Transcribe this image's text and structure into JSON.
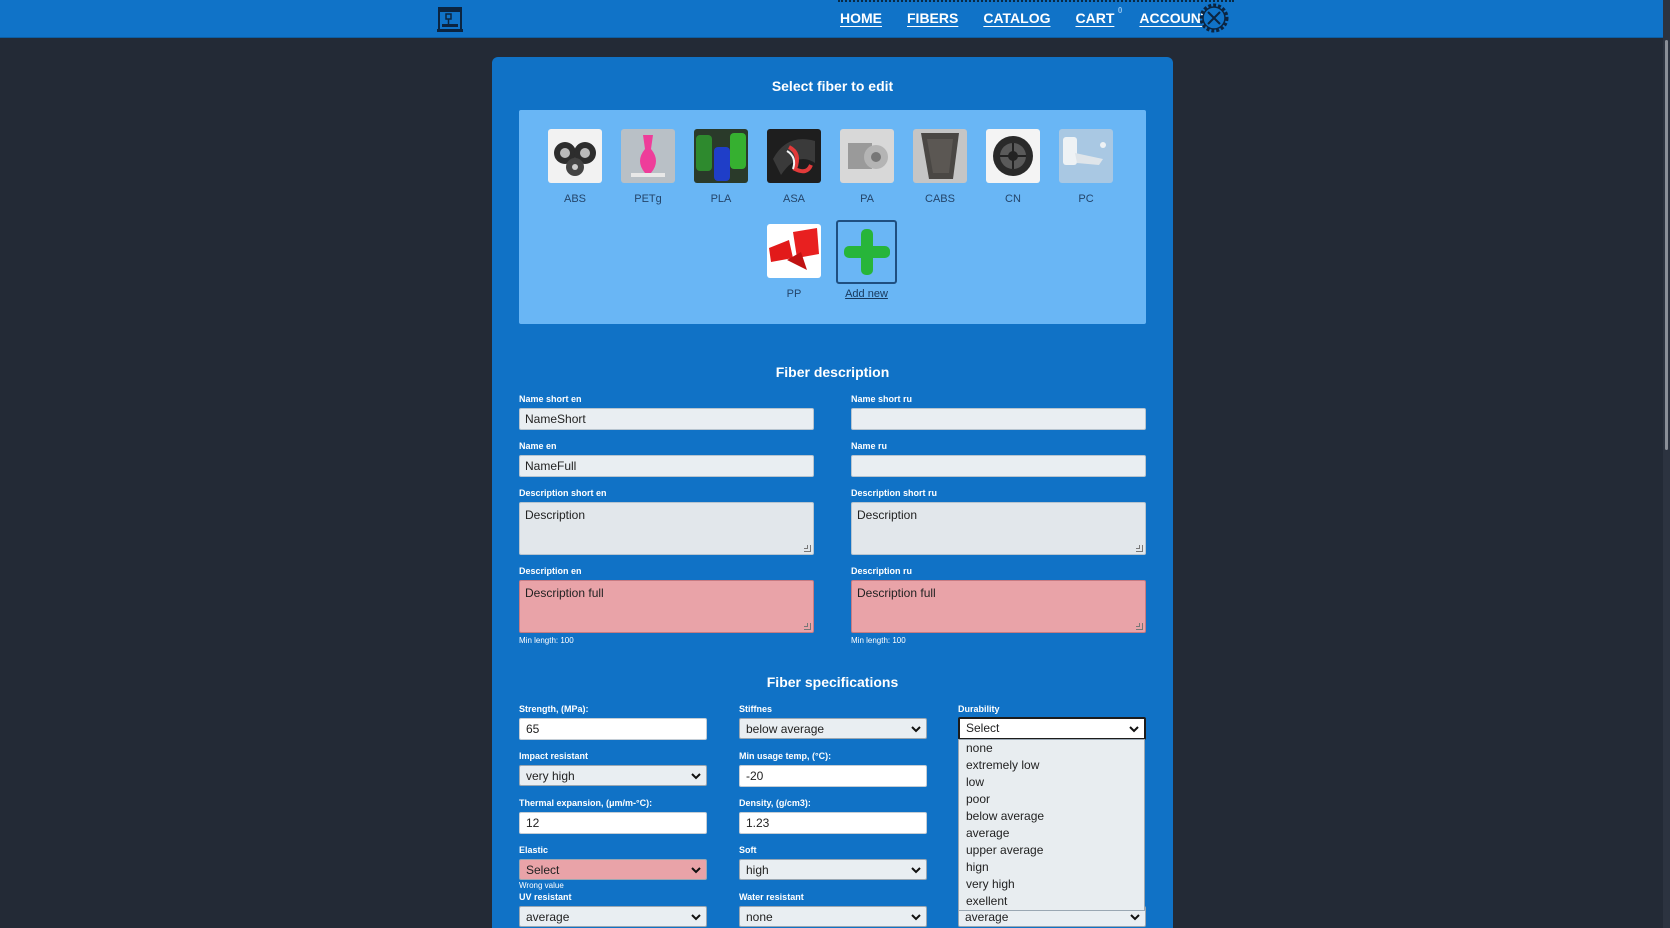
{
  "nav": {
    "links": [
      {
        "label": "HOME"
      },
      {
        "label": "FIBERS"
      },
      {
        "label": "CATALOG"
      },
      {
        "label": "CART",
        "badge": "0"
      },
      {
        "label": "ACCOUNT"
      }
    ]
  },
  "fiber_select": {
    "title": "Select fiber to edit",
    "fibers": [
      {
        "label": "ABS"
      },
      {
        "label": "PETg"
      },
      {
        "label": "PLA"
      },
      {
        "label": "ASA"
      },
      {
        "label": "PA"
      },
      {
        "label": "CABS"
      },
      {
        "label": "CN"
      },
      {
        "label": "PC"
      },
      {
        "label": "PP"
      }
    ],
    "add_label": "Add new"
  },
  "description": {
    "title": "Fiber description",
    "name_short_en": {
      "label": "Name short en",
      "value": "NameShort"
    },
    "name_short_ru": {
      "label": "Name short ru",
      "value": ""
    },
    "name_en": {
      "label": "Name en",
      "value": "NameFull"
    },
    "name_ru": {
      "label": "Name ru",
      "value": ""
    },
    "desc_short_en": {
      "label": "Description short en",
      "value": "Description"
    },
    "desc_short_ru": {
      "label": "Description short ru",
      "value": "Description"
    },
    "desc_en": {
      "label": "Description en",
      "value": "Description full",
      "hint": "Min length: 100"
    },
    "desc_ru": {
      "label": "Description ru",
      "value": "Description full",
      "hint": "Min length: 100"
    }
  },
  "specs": {
    "title": "Fiber specifications",
    "strength": {
      "label": "Strength, (MPa):",
      "value": "65"
    },
    "stiffnes": {
      "label": "Stiffnes",
      "value": "below average"
    },
    "durability": {
      "label": "Durability",
      "value": "Select"
    },
    "impact": {
      "label": "Impact resistant",
      "value": "very high"
    },
    "min_temp": {
      "label": "Min usage temp, (°C):",
      "value": "-20"
    },
    "thermal": {
      "label": "Thermal expansion, (μm/m-°C):",
      "value": "12"
    },
    "density": {
      "label": "Density, (g/cm3):",
      "value": "1.23"
    },
    "elastic": {
      "label": "Elastic",
      "value": "Select",
      "error": "Wrong value"
    },
    "soft": {
      "label": "Soft",
      "value": "high"
    },
    "uv": {
      "label": "UV resistant",
      "value": "average"
    },
    "water": {
      "label": "Water resistant",
      "value": "none"
    },
    "third_col_last": {
      "value": "average"
    }
  },
  "durability_options": [
    "none",
    "extremely low",
    "low",
    "poor",
    "below average",
    "average",
    "upper average",
    "hign",
    "very high",
    "exellent"
  ]
}
